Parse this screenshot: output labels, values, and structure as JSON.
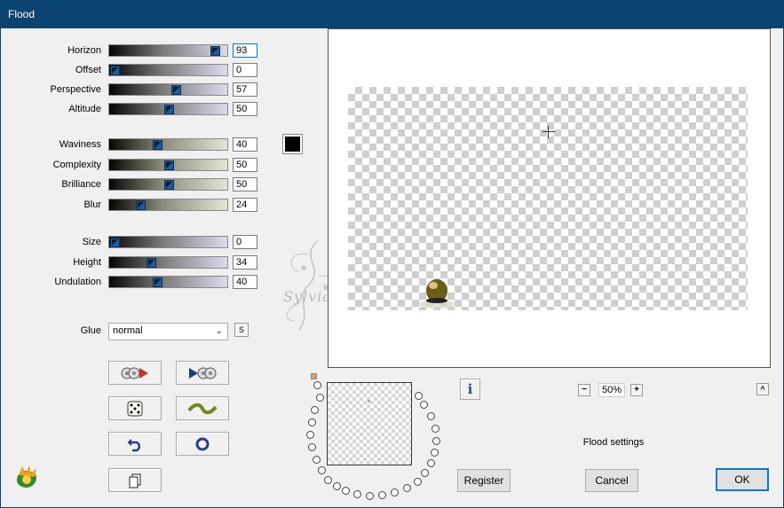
{
  "window": {
    "title": "Flood"
  },
  "sliders_group1": [
    {
      "label": "Horizon",
      "value": "93",
      "fraction": 0.93,
      "style": "g1",
      "focused": true
    },
    {
      "label": "Offset",
      "value": "0",
      "fraction": 0.0,
      "style": "g1"
    },
    {
      "label": "Perspective",
      "value": "57",
      "fraction": 0.57,
      "style": "g1"
    },
    {
      "label": "Altitude",
      "value": "50",
      "fraction": 0.5,
      "style": "g1"
    }
  ],
  "sliders_group2": [
    {
      "label": "Waviness",
      "value": "40",
      "fraction": 0.4,
      "style": "g2"
    },
    {
      "label": "Complexity",
      "value": "50",
      "fraction": 0.5,
      "style": "g2"
    },
    {
      "label": "Brilliance",
      "value": "50",
      "fraction": 0.5,
      "style": "g2"
    },
    {
      "label": "Blur",
      "value": "24",
      "fraction": 0.24,
      "style": "g2"
    }
  ],
  "sliders_group3": [
    {
      "label": "Size",
      "value": "0",
      "fraction": 0.0,
      "style": "g1"
    },
    {
      "label": "Height",
      "value": "34",
      "fraction": 0.34,
      "style": "g1"
    },
    {
      "label": "Undulation",
      "value": "40",
      "fraction": 0.4,
      "style": "g1"
    }
  ],
  "color_swatch": "#000000",
  "glue": {
    "label": "Glue",
    "value": "normal",
    "s_button": "S"
  },
  "preview_zoom": "50%",
  "zoom_minus": "−",
  "zoom_plus": "+",
  "caret_button": "^",
  "info_icon": "i",
  "status_text": "Flood settings",
  "buttons": {
    "register": "Register",
    "cancel": "Cancel",
    "ok": "OK"
  },
  "watermark_text": "Sylviane",
  "colors": {
    "titlebar": "#0b4470",
    "accent": "#0078d7"
  }
}
